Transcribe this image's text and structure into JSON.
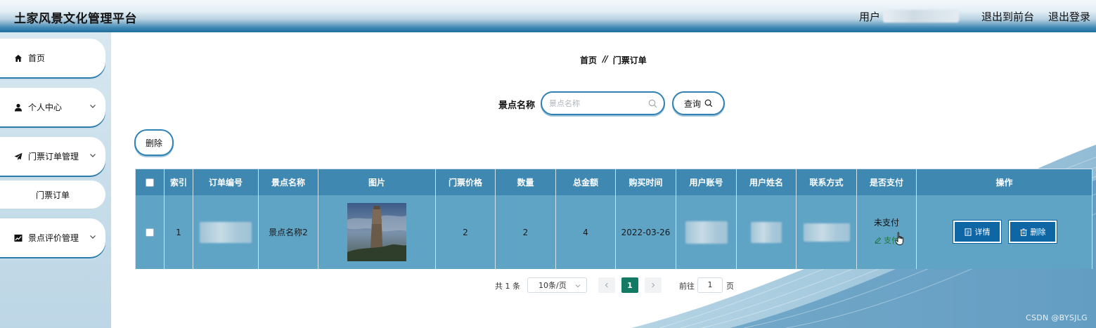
{
  "header": {
    "title": "土家风景文化管理平台",
    "user_label": "用户",
    "links": [
      "退出到前台",
      "退出登录"
    ]
  },
  "sidebar": {
    "items": [
      {
        "label": "首页",
        "icon": "home-icon"
      },
      {
        "label": "个人中心",
        "icon": "user-icon"
      },
      {
        "label": "门票订单管理",
        "icon": "paper-plane-icon"
      },
      {
        "label": "景点评价管理",
        "icon": "chart-icon"
      }
    ],
    "submenu": {
      "label": "门票订单"
    }
  },
  "breadcrumb": {
    "home": "首页",
    "separator": "//",
    "current": "门票订单"
  },
  "search": {
    "label": "景点名称",
    "placeholder": "景点名称",
    "value": "",
    "button_label": "查询"
  },
  "toolbar": {
    "delete_label": "删除"
  },
  "table": {
    "columns": [
      "索引",
      "订单编号",
      "景点名称",
      "图片",
      "门票价格",
      "数量",
      "总金额",
      "购买时间",
      "用户账号",
      "用户姓名",
      "联系方式",
      "是否支付",
      "操作"
    ],
    "rows": [
      {
        "index": "1",
        "attraction_name": "景点名称2",
        "ticket_price": "2",
        "quantity": "2",
        "total": "4",
        "purchase_time": "2022-03-26",
        "pay_status": "未支付",
        "pay_link": "支付",
        "detail_label": "详情",
        "delete_label": "删除"
      }
    ]
  },
  "pagination": {
    "total": "共 1 条",
    "page_size": "10条/页",
    "current_page": "1",
    "goto_label": "前往",
    "goto_value": "1",
    "page_unit": "页"
  },
  "watermark": "CSDN @BYSJLG",
  "colors": {
    "header_blue": "#1f6e9d",
    "table_header": "#3f88b2",
    "table_row": "#5fa3c5",
    "action_button": "#0f66a5",
    "pager_active": "#137a63",
    "pay_link": "#1c7a3a"
  }
}
